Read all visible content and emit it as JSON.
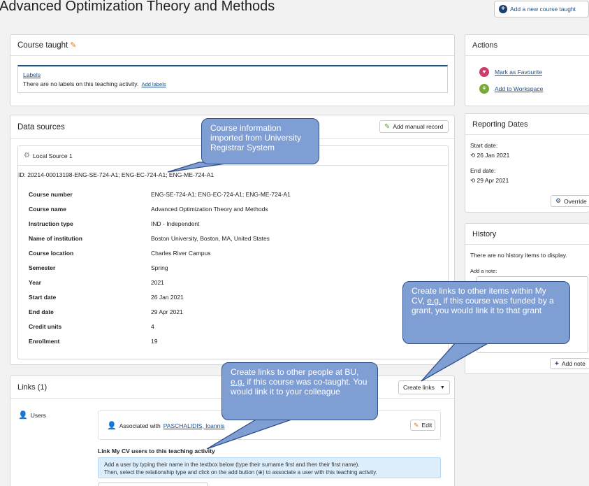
{
  "page": {
    "title": "Advanced Optimization Theory and Methods",
    "add_course_label": "Add a new course taught"
  },
  "course_taught": {
    "header": "Course taught",
    "labels_link": "Labels",
    "no_labels_text": "There are no labels on this teaching activity.",
    "add_labels": "Add labels"
  },
  "data_sources": {
    "header": "Data sources",
    "add_manual_label": "Add manual record",
    "source_name": "Local Source 1",
    "id_text": "ID: 20214-00013198-ENG-SE-724-A1; ENG-EC-724-A1; ENG-ME-724-A1",
    "rows": [
      {
        "label": "Course number",
        "value": "ENG-SE-724-A1; ENG-EC-724-A1; ENG-ME-724-A1"
      },
      {
        "label": "Course name",
        "value": "Advanced Optimization Theory and Methods"
      },
      {
        "label": "Instruction type",
        "value": "IND - Independent"
      },
      {
        "label": "Name of institution",
        "value": "Boston University, Boston, MA, United States"
      },
      {
        "label": "Course location",
        "value": "Charles River Campus"
      },
      {
        "label": "Semester",
        "value": "Spring"
      },
      {
        "label": "Year",
        "value": "2021"
      },
      {
        "label": "Start date",
        "value": "26 Jan 2021"
      },
      {
        "label": "End date",
        "value": "29 Apr 2021"
      },
      {
        "label": "Credit units",
        "value": "4"
      },
      {
        "label": "Enrollment",
        "value": "19"
      }
    ]
  },
  "actions": {
    "header": "Actions",
    "favourite": "Mark as Favourite",
    "workspace": "Add to Workspace"
  },
  "reporting_dates": {
    "header": "Reporting Dates",
    "start_label": "Start date:",
    "start_value": "26 Jan 2021",
    "end_label": "End date:",
    "end_value": "29 Apr 2021",
    "override_label": "Override"
  },
  "history": {
    "header": "History",
    "empty_text": "There are no history items to display.",
    "note_label": "Add a note:",
    "add_note_label": "Add note"
  },
  "links": {
    "header": "Links (1)",
    "create_links_label": "Create links",
    "users_label": "Users",
    "associated_prefix": "Associated with",
    "associated_name": "PASCHALIDIS, Ioannis",
    "edit_label": "Edit",
    "link_users_title": "Link My CV users to this teaching activity",
    "info_line1": "Add a user by typing their name in the textbox below (type their surname first and then their first name).",
    "info_line2": "Then, select the relationship type and click on the add button (⊕) to associate a user with this teaching activity."
  },
  "callouts": {
    "course_info": "Course information imported from University Registrar System",
    "cv_links_pre": "Create links to other items within My CV,",
    "cv_links_eg": "e.g.",
    "cv_links_post": "if this course was funded by a grant, you would link it to that grant",
    "people_pre": "Create links to other people at BU,",
    "people_eg": "e.g.",
    "people_post": "if this course was co-taught. You would link it to your colleague"
  },
  "colors": {
    "link": "#1a4f8b",
    "callout_fill": "#7f9ed4",
    "callout_border": "#2f4f86",
    "heart": "#cc3d6a",
    "workspace": "#7aa83a",
    "user_icon": "#f0a422",
    "edit_icon": "#e07b20"
  }
}
